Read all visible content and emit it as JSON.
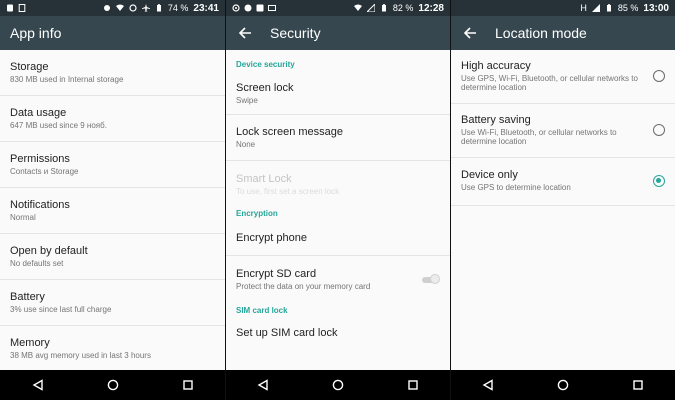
{
  "colors": {
    "accent": "#26a69a",
    "appbar": "#37474f",
    "statusbar": "#263238"
  },
  "panel1": {
    "status": {
      "battery_pct": "74 %",
      "time": "23:41"
    },
    "title": "App info",
    "items": [
      {
        "title": "Storage",
        "sub": "830 MB used in Internal storage"
      },
      {
        "title": "Data usage",
        "sub": "647 MB used since 9 нояб."
      },
      {
        "title": "Permissions",
        "sub": "Contacts и Storage"
      },
      {
        "title": "Notifications",
        "sub": "Normal"
      },
      {
        "title": "Open by default",
        "sub": "No defaults set"
      },
      {
        "title": "Battery",
        "sub": "3% use since last full charge"
      },
      {
        "title": "Memory",
        "sub": "38 MB avg memory used in last 3 hours"
      }
    ]
  },
  "panel2": {
    "status": {
      "battery_pct": "82 %",
      "time": "12:28"
    },
    "title": "Security",
    "cat_device": "Device security",
    "screen_lock": {
      "title": "Screen lock",
      "sub": "Swipe"
    },
    "lock_msg": {
      "title": "Lock screen message",
      "sub": "None"
    },
    "smart_lock": {
      "title": "Smart Lock",
      "sub": "To use, first set a screen lock"
    },
    "cat_encryption": "Encryption",
    "encrypt_phone": {
      "title": "Encrypt phone"
    },
    "encrypt_sd": {
      "title": "Encrypt SD card",
      "sub": "Protect the data on your memory card",
      "toggle": "off"
    },
    "cat_sim": "SIM card lock",
    "sim_lock": {
      "title": "Set up SIM card lock"
    }
  },
  "panel3": {
    "status": {
      "network": "H",
      "battery_pct": "85 %",
      "time": "13:00"
    },
    "title": "Location mode",
    "modes": [
      {
        "title": "High accuracy",
        "sub": "Use GPS, Wi-Fi, Bluetooth, or cellular networks to determine location",
        "selected": false
      },
      {
        "title": "Battery saving",
        "sub": "Use Wi-Fi, Bluetooth, or cellular networks to determine location",
        "selected": false
      },
      {
        "title": "Device only",
        "sub": "Use GPS to determine location",
        "selected": true
      }
    ]
  },
  "icons": {
    "back": "arrow-left-icon",
    "nav_back": "triangle-back-icon",
    "nav_home": "circle-home-icon",
    "nav_recent": "square-recent-icon"
  }
}
